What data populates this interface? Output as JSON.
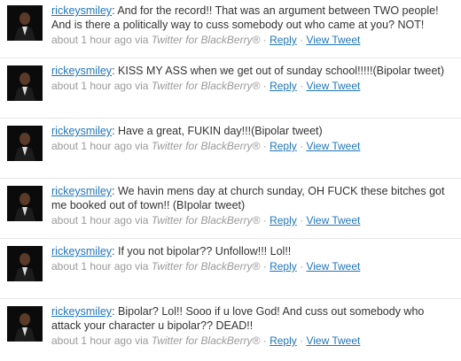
{
  "tweets": [
    {
      "user": "rickeysmiley",
      "text": ": And for the record!! That was an argument between TWO people! And is there a politically way to cuss somebody out who came at you? NOT!",
      "time": "about 1 hour ago",
      "via_label": " via ",
      "source": "Twitter for BlackBerry®",
      "sep1": " · ",
      "reply": "Reply",
      "sep2": " · ",
      "view": "View Tweet"
    },
    {
      "user": "rickeysmiley",
      "text": ": KISS MY ASS when we get out of sunday school!!!!!(Bipolar tweet)",
      "time": "about 1 hour ago",
      "via_label": " via ",
      "source": "Twitter for BlackBerry®",
      "sep1": " · ",
      "reply": "Reply",
      "sep2": " · ",
      "view": "View Tweet"
    },
    {
      "user": "rickeysmiley",
      "text": ": Have a great, FUKIN day!!!(Bipolar tweet)",
      "time": "about 1 hour ago",
      "via_label": " via ",
      "source": "Twitter for BlackBerry®",
      "sep1": " · ",
      "reply": "Reply",
      "sep2": " · ",
      "view": "View Tweet"
    },
    {
      "user": "rickeysmiley",
      "text": ": We havin mens day at church sunday, OH FUCK these bitches got me booked out of town!! (BIpolar tweet)",
      "time": "about 1 hour ago",
      "via_label": " via ",
      "source": "Twitter for BlackBerry®",
      "sep1": " · ",
      "reply": "Reply",
      "sep2": " · ",
      "view": "View Tweet"
    },
    {
      "user": "rickeysmiley",
      "text": ": If you not bipolar?? Unfollow!!! Lol!!",
      "time": "about 1 hour ago",
      "via_label": " via ",
      "source": "Twitter for BlackBerry®",
      "sep1": " · ",
      "reply": "Reply",
      "sep2": " · ",
      "view": "View Tweet"
    },
    {
      "user": "rickeysmiley",
      "text": ": Bipolar? Lol!! Sooo if u love God! And cuss out somebody who attack your character u bipolar?? DEAD!!",
      "time": "about 1 hour ago",
      "via_label": " via ",
      "source": "Twitter for BlackBerry®",
      "sep1": " · ",
      "reply": "Reply",
      "sep2": " · ",
      "view": "View Tweet"
    }
  ],
  "colors": {
    "link": "#2276bb",
    "text": "#333333",
    "meta": "#999999",
    "divider": "#e6e6e6"
  },
  "icons": {
    "avatar": "user-profile-photo"
  }
}
